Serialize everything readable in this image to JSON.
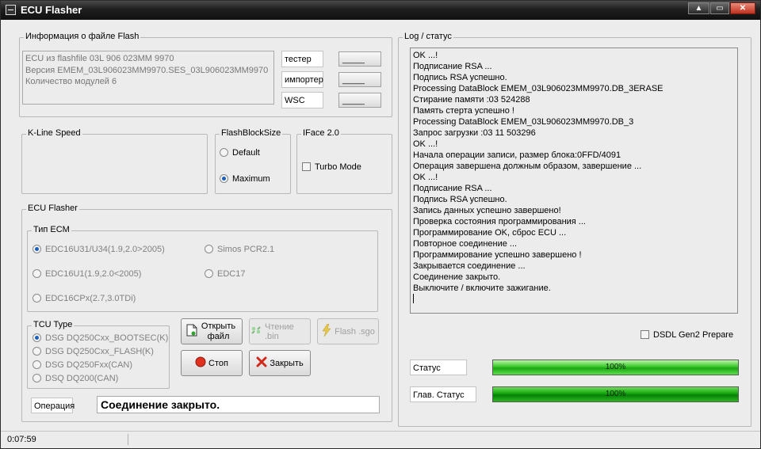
{
  "window": {
    "title": "ECU Flasher",
    "controls": {
      "minimize": "▲",
      "maximize": "▭",
      "close": "✕"
    }
  },
  "file_info": {
    "legend": "Информация  о файле Flash",
    "lines": [
      "ECU из flashfile 03L 906 023MM 9970",
      "Версия EMEM_03L906023MM9970.SES_03L906023MM9970",
      "Количество модулей 6"
    ],
    "fields": [
      {
        "label": "тестер",
        "value": "_____"
      },
      {
        "label": "импортер",
        "value": "_____"
      },
      {
        "label": "WSC",
        "value": "_____"
      }
    ]
  },
  "kline": {
    "legend": "K-Line Speed"
  },
  "flashblock": {
    "legend": "FlashBlockSize",
    "options": [
      {
        "label": "Default",
        "selected": false
      },
      {
        "label": "Maximum",
        "selected": true
      }
    ]
  },
  "iface": {
    "legend": "IFace 2.0",
    "turbo_label": "Turbo Mode",
    "turbo_checked": false
  },
  "ecu_flasher": {
    "legend": "ECU Flasher",
    "ecm_type": {
      "legend": "Тип ECM",
      "options": [
        {
          "label": "EDC16U31/U34(1.9,2.0>2005)",
          "selected": true
        },
        {
          "label": "Simos PCR2.1",
          "selected": false
        },
        {
          "label": "EDC16U1(1.9,2.0<2005)",
          "selected": false
        },
        {
          "label": "EDC17",
          "selected": false
        },
        {
          "label": "EDC16CPx(2.7,3.0TDi)",
          "selected": false
        }
      ]
    },
    "tcu_type": {
      "legend": "TCU Type",
      "options": [
        {
          "label": "DSG DQ250Cxx_BOOTSEC(K)",
          "selected": true
        },
        {
          "label": "DSG DQ250Cxx_FLASH(K)",
          "selected": false
        },
        {
          "label": "DSG DQ250Fxx(CAN)",
          "selected": false
        },
        {
          "label": "DSQ DQ200(CAN)",
          "selected": false
        }
      ]
    },
    "buttons": {
      "open_file": "Открыть файл",
      "read_bin": "Чтение .bin",
      "flash_sgo": "Flash .sgo",
      "stop": "Стоп",
      "close": "Закрыть"
    },
    "operation_label": "Операция",
    "operation_text": "Соединение закрыто."
  },
  "log": {
    "legend": "Log / статус",
    "lines": [
      "OK ...!",
      "Подписание RSA ...",
      "Подпись RSA успешно.",
      "Processing DataBlock EMEM_03L906023MM9970.DB_3ERASE",
      "Стирание памяти :03 524288",
      "Память стерта успешно !",
      "Processing DataBlock EMEM_03L906023MM9970.DB_3",
      "Запрос загрузки :03 11 503296",
      "OK ...!",
      "Начала операции записи, размер блока:0FFD/4091",
      "Операция завершена должным образом, завершение ...",
      "OK ...!",
      "Подписание RSA ...",
      "Подпись RSA успешно.",
      "Запись данных успешно завершено!",
      "Проверка состояния программирования ...",
      "Программирование OK, сброс ECU ...",
      "Повторное соединение ...",
      "Программирование успешно завершено !",
      "Закрывается соединение ...",
      "Соединение закрыто.",
      "Выключите / включите зажигание."
    ],
    "dsdl_label": "DSDL Gen2 Prepare",
    "dsdl_checked": false
  },
  "status": {
    "status_label": "Статус",
    "status_value": 100,
    "status_text": "100%",
    "main_label": "Глав. Статус",
    "main_value": 100,
    "main_text": "100%"
  },
  "statusbar": {
    "time": "0:07:59"
  }
}
